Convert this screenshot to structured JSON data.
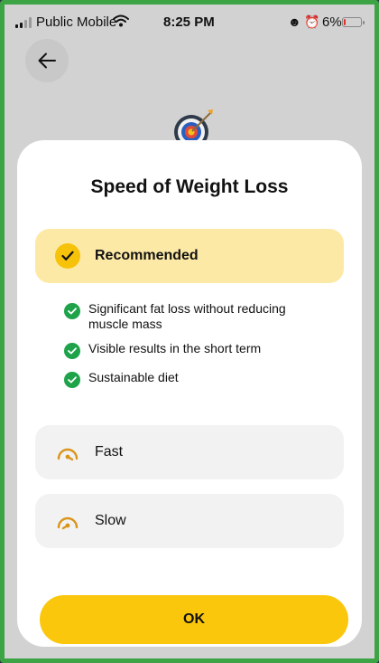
{
  "status_bar": {
    "carrier": "Public Mobile",
    "time": "8:25 PM",
    "battery": "6%",
    "icons": [
      "signal-icon",
      "wifi-icon",
      "face-icon",
      "alarm-icon",
      "battery-icon"
    ]
  },
  "header": {
    "back_icon": "arrow-left-icon",
    "hero_icon": "target-dart-icon"
  },
  "sheet": {
    "title": "Speed of Weight Loss",
    "options": [
      {
        "label": "Recommended",
        "icon": "check-circle-icon",
        "selected": true,
        "benefits": [
          "Significant fat loss without reducing muscle mass",
          "Visible results in the short term",
          "Sustainable diet"
        ]
      },
      {
        "label": "Fast",
        "icon": "speed-gauge-fast-icon",
        "selected": false
      },
      {
        "label": "Slow",
        "icon": "speed-gauge-slow-icon",
        "selected": false
      }
    ],
    "ok_label": "OK"
  },
  "colors": {
    "accent": "#fbc70c",
    "selected_bg": "#fde9a6",
    "option_bg": "#f2f2f2",
    "benefit_check": "#1fa34a",
    "gauge": "#d9951a",
    "frame_border": "#3da446"
  }
}
